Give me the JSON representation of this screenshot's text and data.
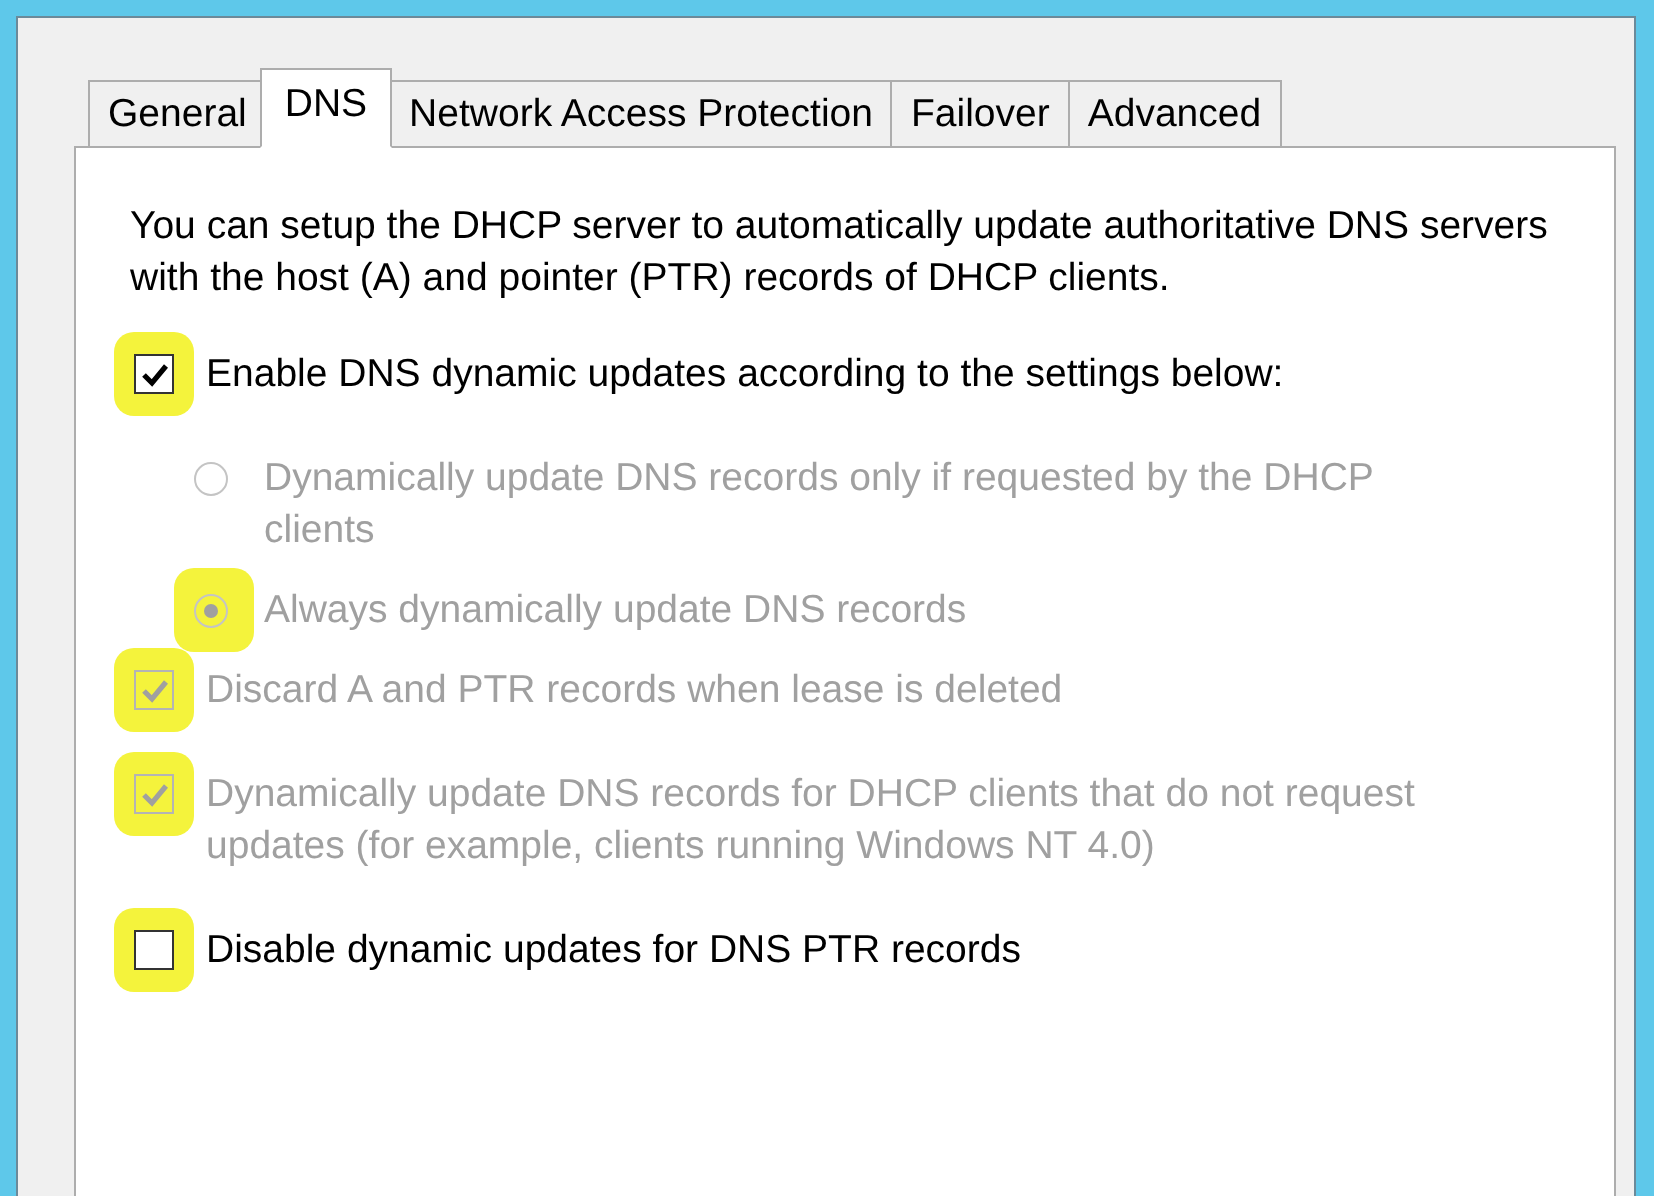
{
  "tabs": [
    {
      "label": "General",
      "selected": false
    },
    {
      "label": "DNS",
      "selected": true
    },
    {
      "label": "Network Access Protection",
      "selected": false
    },
    {
      "label": "Failover",
      "selected": false
    },
    {
      "label": "Advanced",
      "selected": false
    }
  ],
  "description": "You can setup the DHCP server to automatically update authoritative DNS servers with the host (A) and pointer (PTR) records of DHCP clients.",
  "options": [
    {
      "kind": "checkbox",
      "label": "Enable DNS dynamic updates according to the settings below:",
      "checked": true,
      "disabled": false,
      "highlighted": true,
      "children": [
        {
          "kind": "radio",
          "label": "Dynamically update DNS records only if requested by the DHCP clients",
          "selected": false,
          "disabled": true,
          "highlighted": false
        },
        {
          "kind": "radio",
          "label": "Always dynamically update DNS records",
          "selected": true,
          "disabled": true,
          "highlighted": true
        }
      ]
    },
    {
      "kind": "checkbox",
      "label": "Discard A and PTR records when lease is deleted",
      "checked": true,
      "disabled": true,
      "highlighted": true
    },
    {
      "kind": "checkbox",
      "label": "Dynamically update DNS records for DHCP clients that do not request updates (for example, clients running Windows NT 4.0)",
      "checked": true,
      "disabled": true,
      "highlighted": true
    },
    {
      "kind": "checkbox",
      "label": "Disable dynamic updates for DNS PTR records",
      "checked": false,
      "disabled": false,
      "highlighted": true
    }
  ]
}
